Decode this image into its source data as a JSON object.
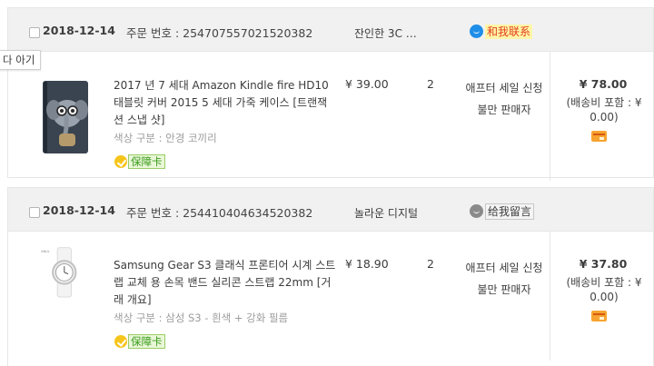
{
  "orders": [
    {
      "date": "2018-12-14",
      "order_no": "주문 번호 : 254707557021520382",
      "shop": "잔인한 3C …",
      "contact_label": "和我联系",
      "contact_color": "#1f8ee8",
      "item": {
        "title": "2017 년 7 세대 Amazon Kindle fire HD10 태블릿 커버 2015 5 세대 가죽 케이스 [트랜잭션 스냅 샷]",
        "variant": "색상 구분 : 안경 코끼리",
        "warranty": "保障卡",
        "price": "¥ 39.00",
        "qty": "2",
        "after_sale": "애프터 세일 신청",
        "complain": "불만 판매자",
        "total": "¥ 78.00",
        "shipping": "(배송비 포함 : ¥ 0.00)"
      }
    },
    {
      "date": "2018-12-14",
      "order_no": "주문 번호 : 254410404634520382",
      "shop": "놀라운 디지털",
      "contact_label": "给我留言",
      "contact_color": "#8a8a8a",
      "item": {
        "title": "Samsung Gear S3 클래식 프론티어 시계 스트랩 교체 용 손목 밴드 실리콘 스트랩 22mm [거래 개요]",
        "variant": "색상 구분 : 삼성 S3 - 흰색 + 강화 필름",
        "warranty": "保障卡",
        "price": "¥ 18.90",
        "qty": "2",
        "after_sale": "애프터 세일 신청",
        "complain": "불만 판매자",
        "total": "¥ 37.80",
        "shipping": "(배송비 포함 : ¥ 0.00)"
      }
    }
  ],
  "tooltip": "다 아기"
}
